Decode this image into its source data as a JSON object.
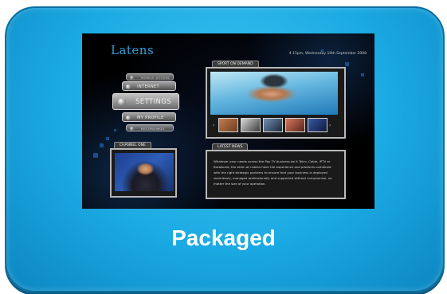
{
  "card": {
    "label": "Packaged",
    "colors": {
      "card_fill": "#1aa9e2",
      "card_border": "#0b6e9f",
      "label_text": "#ffffff"
    }
  },
  "tv_ui": {
    "logo": "Latens",
    "datetime": "4.15pm, Wednesday 10th September 2008",
    "menu": {
      "top_small": "MOBILE ACCESS",
      "items": [
        "INTERNET",
        "SETTINGS",
        "MY PROFILE"
      ],
      "selected": "SETTINGS",
      "bottom_small": "RECORDINGS"
    },
    "sport_panel": {
      "title": "SPORT ON DEMAND",
      "thumbnail_count": 5,
      "nav_arrows": {
        "left": "‹",
        "right": "›"
      }
    },
    "channel_panel": {
      "title": "CHANNEL ONE"
    },
    "news_panel": {
      "title": "LATEST NEWS",
      "body": "Whatever your needs across the Pay TV business be it Telco, Cable, IPTV or Broadcast, the team at Latens have the experience and products combined with the right strategic partners to ensure that your business is deployed seamlessly, managed professionally and supported without compromise, no matter the size of your operation."
    },
    "colors": {
      "background": "#000000",
      "logo": "#2ea0e0",
      "menu_fill": "#7a7a7a",
      "accent_blue": "#2a6fc2"
    }
  }
}
